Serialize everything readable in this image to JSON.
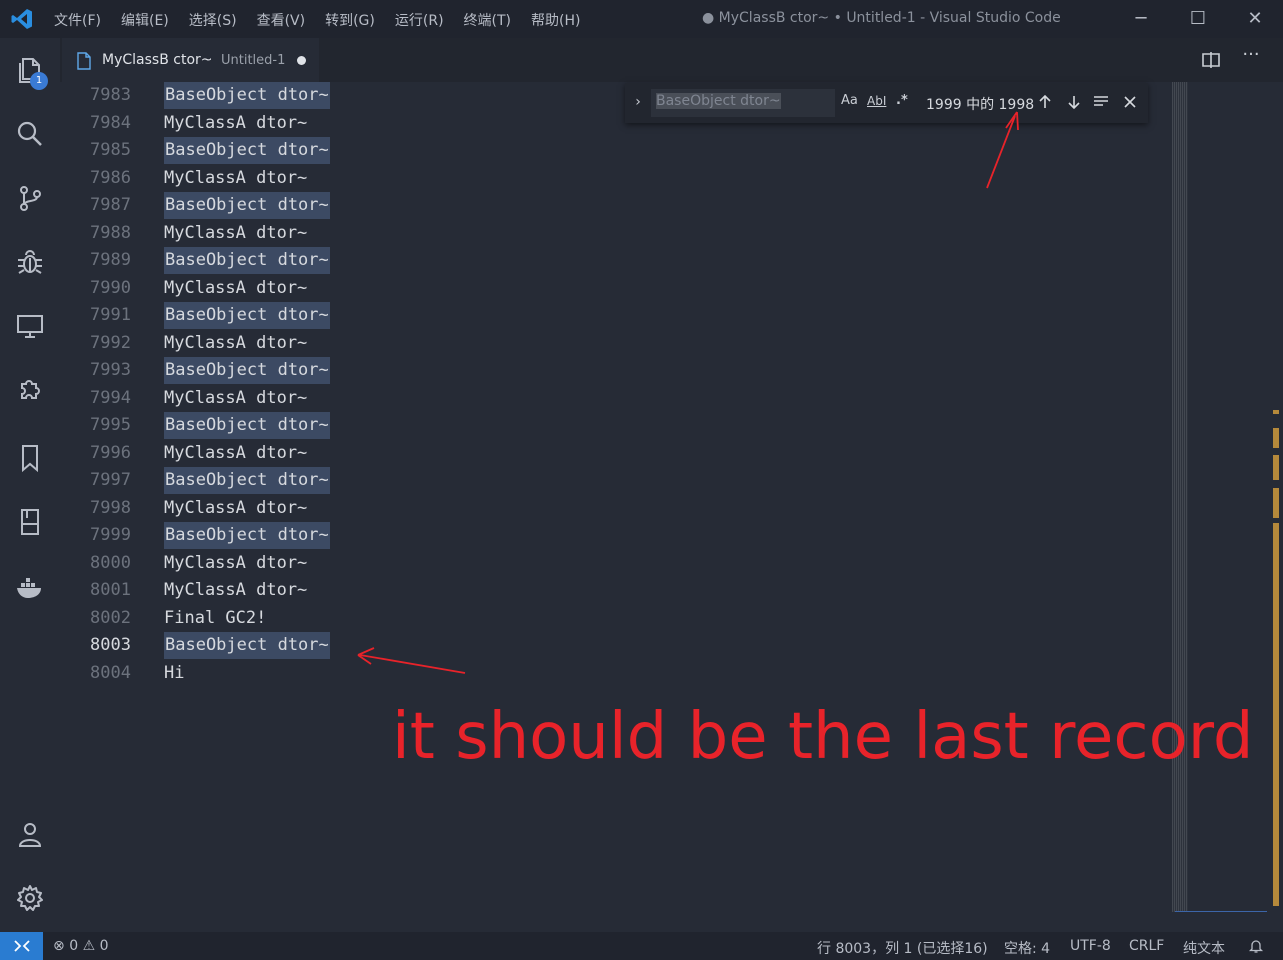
{
  "titlebar": {
    "menu": [
      "文件(F)",
      "编辑(E)",
      "选择(S)",
      "查看(V)",
      "转到(G)",
      "运行(R)",
      "终端(T)",
      "帮助(H)"
    ],
    "window_title": "● MyClassB ctor~ • Untitled-1 - Visual Studio Code",
    "minimize": "─",
    "maximize": "☐",
    "close": "✕"
  },
  "activity_bar": {
    "explorer_badge": "1",
    "icons": [
      "files-icon",
      "search-icon",
      "source-control-icon",
      "debug-icon",
      "remote-explorer-icon",
      "extensions-icon",
      "bookmark-icon",
      "book-icon",
      "docker-icon",
      "account-icon",
      "gear-icon"
    ]
  },
  "tab": {
    "name": "MyClassB ctor~",
    "description": "Untitled-1"
  },
  "tab_actions": {
    "more": "···"
  },
  "editor": {
    "lines": [
      {
        "num": "7983",
        "text": "BaseObject dtor~",
        "match": true
      },
      {
        "num": "7984",
        "text": "MyClassA dtor~",
        "match": false
      },
      {
        "num": "7985",
        "text": "BaseObject dtor~",
        "match": true
      },
      {
        "num": "7986",
        "text": "MyClassA dtor~",
        "match": false
      },
      {
        "num": "7987",
        "text": "BaseObject dtor~",
        "match": true
      },
      {
        "num": "7988",
        "text": "MyClassA dtor~",
        "match": false
      },
      {
        "num": "7989",
        "text": "BaseObject dtor~",
        "match": true
      },
      {
        "num": "7990",
        "text": "MyClassA dtor~",
        "match": false
      },
      {
        "num": "7991",
        "text": "BaseObject dtor~",
        "match": true
      },
      {
        "num": "7992",
        "text": "MyClassA dtor~",
        "match": false
      },
      {
        "num": "7993",
        "text": "BaseObject dtor~",
        "match": true
      },
      {
        "num": "7994",
        "text": "MyClassA dtor~",
        "match": false
      },
      {
        "num": "7995",
        "text": "BaseObject dtor~",
        "match": true
      },
      {
        "num": "7996",
        "text": "MyClassA dtor~",
        "match": false
      },
      {
        "num": "7997",
        "text": "BaseObject dtor~",
        "match": true
      },
      {
        "num": "7998",
        "text": "MyClassA dtor~",
        "match": false
      },
      {
        "num": "7999",
        "text": "BaseObject dtor~",
        "match": true
      },
      {
        "num": "8000",
        "text": "MyClassA dtor~",
        "match": false
      },
      {
        "num": "8001",
        "text": "MyClassA dtor~",
        "match": false
      },
      {
        "num": "8002",
        "text": "Final GC2!",
        "match": false
      },
      {
        "num": "8003",
        "text": "BaseObject dtor~",
        "match": true,
        "current": true
      },
      {
        "num": "8004",
        "text": "Hi",
        "match": false
      }
    ]
  },
  "find_widget": {
    "query": "BaseObject dtor~",
    "match_case": "Aa",
    "whole_word": "AbI",
    "regex": ".*",
    "count": "1999 中的 1998"
  },
  "annotation": {
    "text": "it should be the last record",
    "color": "#e8232a"
  },
  "statusbar": {
    "problems_errors": "0",
    "problems_warnings": "0",
    "cursor": "行 8003，列 1 (已选择16)",
    "indent": "空格: 4",
    "encoding": "UTF-8",
    "eol": "CRLF",
    "language": "纯文本"
  },
  "colors": {
    "accent": "#2a7cd1",
    "match_highlight": "#3c4a63",
    "editor_bg": "#262b36"
  }
}
